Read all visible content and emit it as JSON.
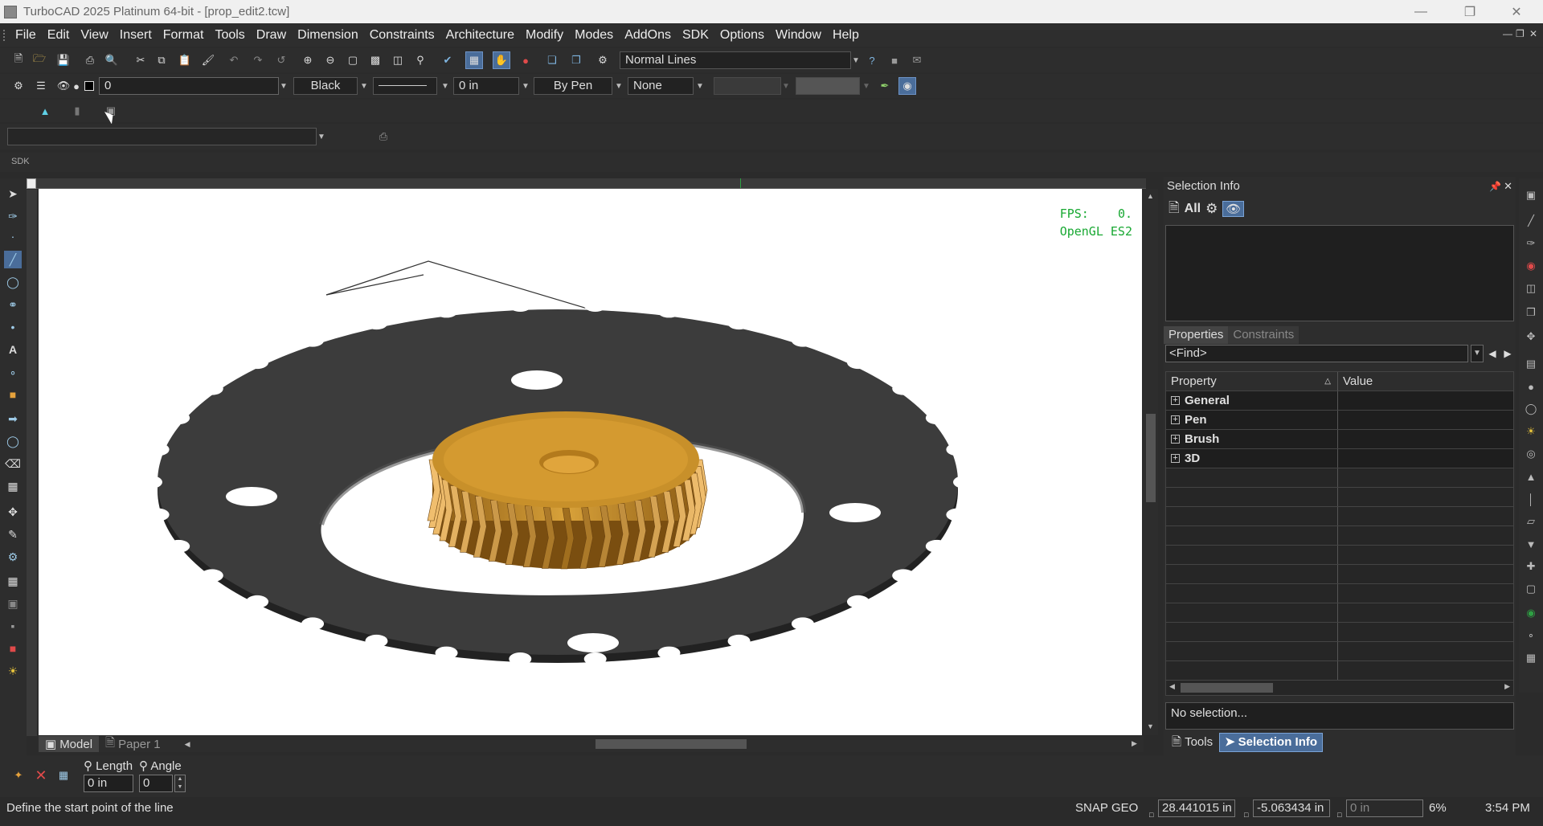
{
  "window": {
    "title": "TurboCAD 2025 Platinum 64-bit - [prop_edit2.tcw]"
  },
  "menu": [
    "File",
    "Edit",
    "View",
    "Insert",
    "Format",
    "Tools",
    "Draw",
    "Dimension",
    "Constraints",
    "Architecture",
    "Modify",
    "Modes",
    "AddOns",
    "SDK",
    "Options",
    "Window",
    "Help"
  ],
  "toolbar1": {
    "line_style": "Normal Lines"
  },
  "toolbar2": {
    "layer": "0",
    "color": "Black",
    "thickness": "0 in",
    "pen_width": "By Pen",
    "fill": "None"
  },
  "sdk_label": "SDK",
  "viewport": {
    "fps_label": "FPS:",
    "fps_value": "0.",
    "renderer": "OpenGL ES2"
  },
  "tabs": {
    "model": "Model",
    "paper": "Paper 1"
  },
  "selection_panel": {
    "title": "Selection Info",
    "all_label": "All",
    "tabs": [
      "Properties",
      "Constraints"
    ],
    "find_placeholder": "<Find>",
    "col_property": "Property",
    "col_value": "Value",
    "groups": [
      "General",
      "Pen",
      "Brush",
      "3D"
    ],
    "status": "No selection...",
    "bottom_tabs": {
      "tools": "Tools",
      "selection": "Selection Info"
    }
  },
  "inspector": {
    "length_label": "Length",
    "angle_label": "Angle",
    "length_value": "0 in",
    "angle_value": "0"
  },
  "status": {
    "prompt": "Define the start point of the line",
    "snap": "SNAP",
    "geo": "GEO",
    "x": "28.441015 in",
    "y": "-5.063434 in",
    "z": "0 in",
    "zoom": "6%",
    "time": "3:54 PM"
  },
  "colors": {
    "accent": "#4a6d9a",
    "gear": "#c8902a",
    "sprocket": "#3a3a3a",
    "fps": "#18a832"
  }
}
